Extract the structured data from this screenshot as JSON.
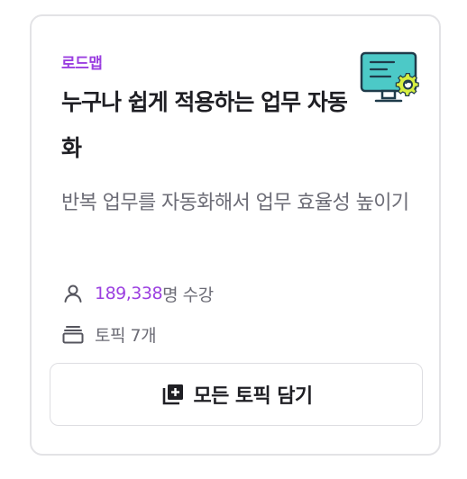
{
  "card": {
    "category": "로드맵",
    "title": "누구나 쉽게 적용하는 업무 자동화",
    "description": "반복 업무를 자동화해서 업무 효율성 높이기",
    "students": {
      "count": "189,338",
      "suffix": "명 수강",
      "icon": "person-icon"
    },
    "topics": {
      "label": "토픽 7개",
      "icon": "stack-icon"
    },
    "thumbnail_icon": "monitor-gear-icon",
    "add_button": {
      "label": "모든 토픽 담기",
      "icon": "add-collection-icon"
    }
  },
  "colors": {
    "accent": "#9b3fe0",
    "title": "#1f1f24",
    "muted": "#6c6c76",
    "border": "#e3e3e6",
    "monitor_screen": "#4cc9c7",
    "gear": "#d7ef3f"
  }
}
